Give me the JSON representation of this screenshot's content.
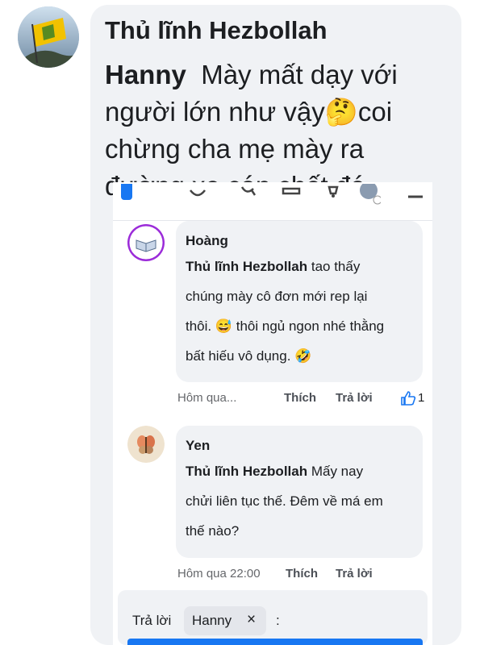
{
  "post": {
    "author": "Thủ lĩnh Hezbollah",
    "mention": "Hanny",
    "text_before_emoji": "Mày mất dạy với người lớn như vậy",
    "emoji": "🤔",
    "text_after_emoji": "coi chừng cha mẹ mày ra đường xe cán chết đó"
  },
  "comments": [
    {
      "name": "Hoàng",
      "mention": "Thủ lĩnh Hezbollah",
      "lines": [
        "tao thấy",
        "chúng mày cô đơn mới rep lại",
        "thôi. 😅 thôi ngủ ngon nhé thằng",
        "bất hiếu vô dụng. 🤣"
      ],
      "time": "Hôm qua...",
      "like_label": "Thích",
      "reply_label": "Trả lời",
      "reaction_count": "1"
    },
    {
      "name": "Yen",
      "mention": "Thủ lĩnh Hezbollah",
      "lines": [
        "Mấy nay",
        "chửi liên tục thế. Đêm về má em",
        "thế nào?"
      ],
      "time": "Hôm qua 22:00",
      "like_label": "Thích",
      "reply_label": "Trả lời"
    }
  ],
  "reply_box": {
    "label": "Trả lời",
    "chip_name": "Hanny",
    "close_symbol": "×",
    "colon": ":"
  },
  "colors": {
    "bubble": "#f0f2f5",
    "accent_blue": "#1877f2",
    "meta_gray": "#65676b"
  },
  "icons": [
    "profile-flag-avatar",
    "book-avatar",
    "butterfly-avatar",
    "thumbs-up-icon",
    "close-icon"
  ]
}
